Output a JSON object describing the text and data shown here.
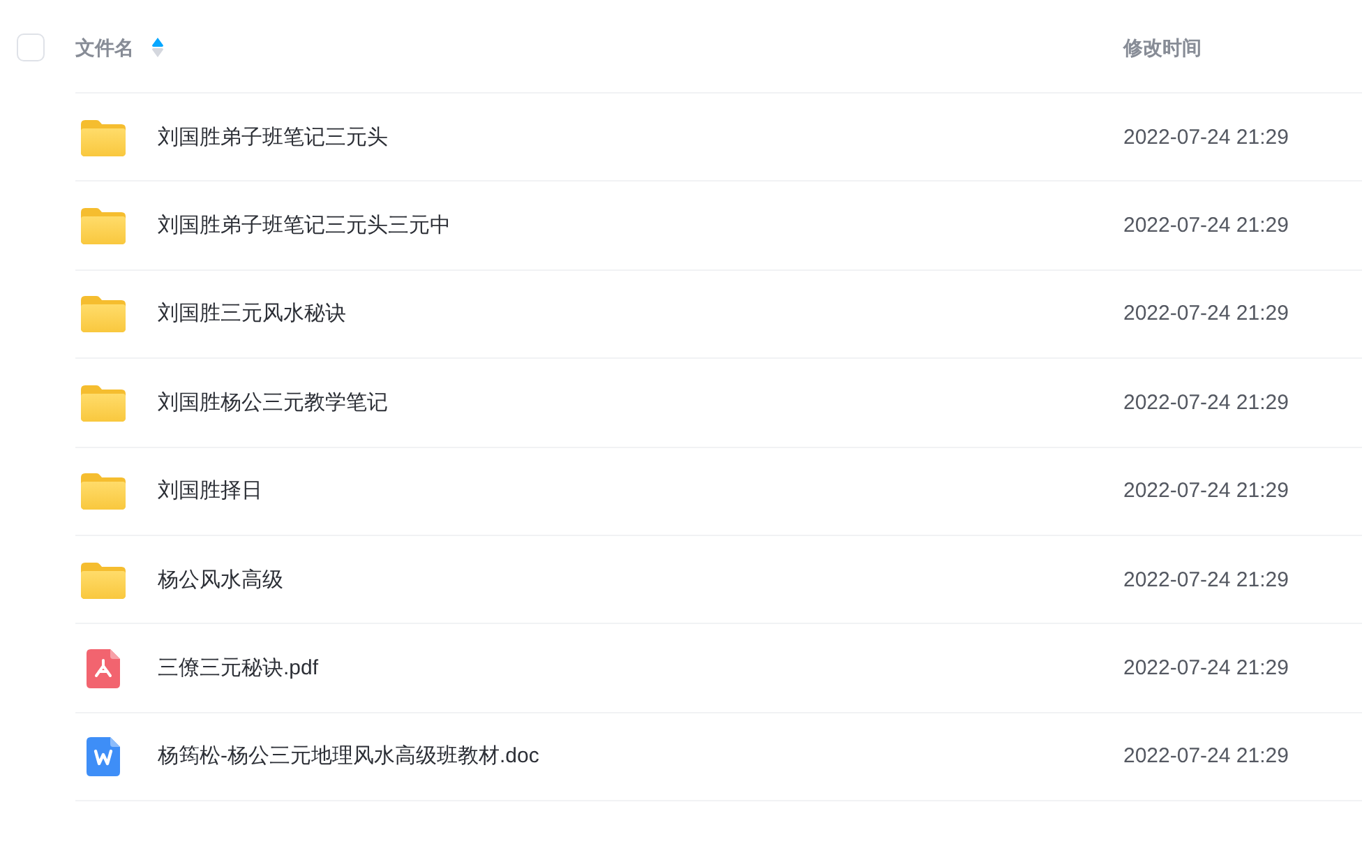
{
  "header": {
    "select_all": {
      "checked": false
    },
    "columns": [
      {
        "label": "文件名",
        "sorted": true,
        "ascending": true
      },
      {
        "label": "修改时间",
        "sorted": false
      }
    ]
  },
  "files": [
    {
      "kind": "folder",
      "name": "刘国胜弟子班笔记三元头",
      "modified": "2022-07-24 21:29"
    },
    {
      "kind": "folder",
      "name": "刘国胜弟子班笔记三元头三元中",
      "modified": "2022-07-24 21:29"
    },
    {
      "kind": "folder",
      "name": "刘国胜三元风水秘诀",
      "modified": "2022-07-24 21:29"
    },
    {
      "kind": "folder",
      "name": "刘国胜杨公三元教学笔记",
      "modified": "2022-07-24 21:29"
    },
    {
      "kind": "folder",
      "name": "刘国胜择日",
      "modified": "2022-07-24 21:29"
    },
    {
      "kind": "folder",
      "name": "杨公风水高级",
      "modified": "2022-07-24 21:29"
    },
    {
      "kind": "pdf",
      "name": "三僚三元秘诀.pdf",
      "modified": "2022-07-24 21:29"
    },
    {
      "kind": "doc",
      "name": "杨筠松-杨公三元地理风水高级班教材.doc",
      "modified": "2022-07-24 21:29"
    }
  ]
}
